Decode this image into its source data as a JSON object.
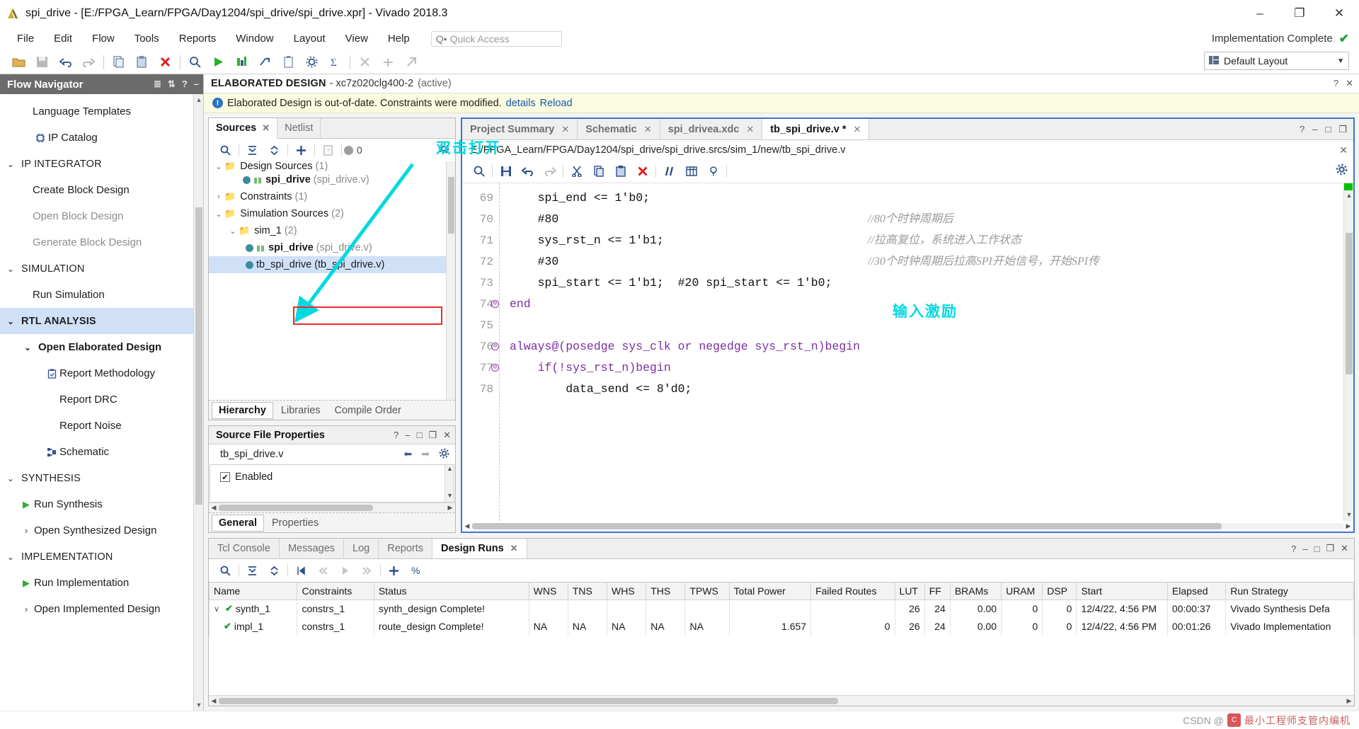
{
  "window": {
    "title": "spi_drive - [E:/FPGA_Learn/FPGA/Day1204/spi_drive/spi_drive.xpr] - Vivado 2018.3",
    "minimize": "–",
    "maximize": "❐",
    "close": "✕"
  },
  "menubar": {
    "items": [
      "File",
      "Edit",
      "Flow",
      "Tools",
      "Reports",
      "Window",
      "Layout",
      "View",
      "Help"
    ],
    "quick_access_placeholder": "Quick Access",
    "quick_access_value": "",
    "impl_status": "Implementation Complete",
    "impl_check": "✔"
  },
  "toolbar": {
    "layout_label": "Default Layout",
    "buttons": [
      "open-project-icon",
      "save-icon",
      "undo-icon",
      "redo-icon",
      "copy-icon",
      "paste-icon",
      "delete-icon",
      "search-icon",
      "run-icon",
      "report-icon",
      "launch-icon",
      "clipboard-icon",
      "settings-icon",
      "sum-icon",
      "marker1-icon",
      "marker2-icon",
      "marker3-icon"
    ]
  },
  "flow_navigator": {
    "header": "Flow Navigator",
    "items": [
      {
        "label": "Language Templates",
        "indent": 1,
        "icon": "",
        "state": "normal"
      },
      {
        "label": "IP Catalog",
        "indent": 1,
        "icon": "ip-catalog-icon",
        "state": "normal"
      },
      {
        "label": "IP INTEGRATOR",
        "indent": 0,
        "icon": "chevron-down-icon",
        "state": "section"
      },
      {
        "label": "Create Block Design",
        "indent": 1,
        "icon": "",
        "state": "normal"
      },
      {
        "label": "Open Block Design",
        "indent": 1,
        "icon": "",
        "state": "disabled"
      },
      {
        "label": "Generate Block Design",
        "indent": 1,
        "icon": "",
        "state": "disabled"
      },
      {
        "label": "SIMULATION",
        "indent": 0,
        "icon": "chevron-down-icon",
        "state": "section"
      },
      {
        "label": "Run Simulation",
        "indent": 1,
        "icon": "",
        "state": "normal"
      },
      {
        "label": "RTL ANALYSIS",
        "indent": 0,
        "icon": "chevron-down-icon",
        "state": "section-active"
      },
      {
        "label": "Open Elaborated Design",
        "indent": 1,
        "icon": "chevron-down-icon",
        "state": "bold"
      },
      {
        "label": "Report Methodology",
        "indent": 2,
        "icon": "methodology-icon",
        "state": "normal"
      },
      {
        "label": "Report DRC",
        "indent": 2,
        "icon": "",
        "state": "normal"
      },
      {
        "label": "Report Noise",
        "indent": 2,
        "icon": "",
        "state": "normal"
      },
      {
        "label": "Schematic",
        "indent": 2,
        "icon": "schematic-icon",
        "state": "normal"
      },
      {
        "label": "SYNTHESIS",
        "indent": 0,
        "icon": "chevron-down-icon",
        "state": "section"
      },
      {
        "label": "Run Synthesis",
        "indent": 1,
        "icon": "play-icon",
        "state": "normal"
      },
      {
        "label": "Open Synthesized Design",
        "indent": 1,
        "icon": "chevron-right-icon",
        "state": "normal"
      },
      {
        "label": "IMPLEMENTATION",
        "indent": 0,
        "icon": "chevron-down-icon",
        "state": "section"
      },
      {
        "label": "Run Implementation",
        "indent": 1,
        "icon": "play-icon",
        "state": "normal"
      },
      {
        "label": "Open Implemented Design",
        "indent": 1,
        "icon": "chevron-right-icon",
        "state": "normal"
      }
    ]
  },
  "design_bar": {
    "title": "ELABORATED DESIGN",
    "part": "- xc7z020clg400-2",
    "active": "(active)"
  },
  "banner": {
    "icon": "!",
    "text": "Elaborated Design is out-of-date. Constraints were modified.",
    "details_link": "details",
    "reload_link": "Reload"
  },
  "sources_panel": {
    "tabs": [
      {
        "label": "Sources",
        "active": true,
        "closable": true
      },
      {
        "label": "Netlist",
        "active": false,
        "closable": false
      }
    ],
    "tool_badge": "0",
    "tools": [
      "search-icon",
      "collapse-all-icon",
      "expand-all-icon",
      "add-sources-icon",
      "help-icon"
    ],
    "tree": [
      {
        "label": "Design Sources",
        "count": "(1)",
        "indent": 0,
        "chev": "down",
        "kind": "folder",
        "clipped": true
      },
      {
        "label": "spi_drive",
        "file": "(spi_drive.v)",
        "indent": 2,
        "chev": "",
        "kind": "module",
        "bold": true
      },
      {
        "label": "Constraints",
        "count": "(1)",
        "indent": 0,
        "chev": "right",
        "kind": "folder"
      },
      {
        "label": "Simulation Sources",
        "count": "(2)",
        "indent": 0,
        "chev": "down",
        "kind": "folder"
      },
      {
        "label": "sim_1",
        "count": "(2)",
        "indent": 1,
        "chev": "down",
        "kind": "folder"
      },
      {
        "label": "spi_drive",
        "file": "(spi_drive.v)",
        "indent": 2,
        "chev": "",
        "kind": "module",
        "bold": true
      },
      {
        "label": "tb_spi_drive",
        "file": "(tb_spi_drive.v)",
        "indent": 2,
        "chev": "",
        "kind": "file",
        "selected": true
      }
    ],
    "subtabs": [
      {
        "label": "Hierarchy",
        "active": true
      },
      {
        "label": "Libraries",
        "active": false
      },
      {
        "label": "Compile Order",
        "active": false
      }
    ]
  },
  "source_file_properties": {
    "title": "Source File Properties",
    "header_icons": [
      "?",
      "–",
      "□",
      "❐",
      "✕"
    ],
    "file_name": "tb_spi_drive.v",
    "enabled_label": "Enabled",
    "enabled_checked": "✔",
    "subtabs": [
      {
        "label": "General",
        "active": true
      },
      {
        "label": "Properties",
        "active": false
      }
    ]
  },
  "editor": {
    "tabs": [
      {
        "label": "Project Summary",
        "active": false
      },
      {
        "label": "Schematic",
        "active": false
      },
      {
        "label": "spi_drivea.xdc",
        "active": false
      },
      {
        "label": "tb_spi_drive.v *",
        "active": true
      }
    ],
    "path": "E:/FPGA_Learn/FPGA/Day1204/spi_drive/spi_drive.srcs/sim_1/new/tb_spi_drive.v",
    "header_icons": [
      "?",
      "–",
      "□",
      "❐"
    ],
    "tools": [
      "find-icon",
      "save-icon",
      "undo-icon",
      "redo-icon",
      "cut-icon",
      "copy-icon",
      "paste-icon",
      "delete-icon",
      "comment-icon",
      "columns-icon",
      "bulb-icon"
    ],
    "gear": "gear-icon",
    "lines": [
      {
        "num": "69",
        "fold": "",
        "code": "    spi_end <= 1'b0;",
        "comment": ""
      },
      {
        "num": "70",
        "fold": "",
        "code": "    #80",
        "comment": "//80个时钟周期后"
      },
      {
        "num": "71",
        "fold": "",
        "code": "    sys_rst_n <= 1'b1;",
        "comment": "//拉高复位，系统进入工作状态"
      },
      {
        "num": "72",
        "fold": "",
        "code": "    #30",
        "comment": "//30个时钟周期后拉高SPI开始信号，开始SPI传"
      },
      {
        "num": "73",
        "fold": "",
        "code": "    spi_start <= 1'b1;  #20 spi_start <= 1'b0;",
        "comment": ""
      },
      {
        "num": "74",
        "fold": "⊖",
        "code": "end",
        "comment": ""
      },
      {
        "num": "75",
        "fold": "",
        "code": "",
        "comment": ""
      },
      {
        "num": "76",
        "fold": "⊖",
        "code": "always@(posedge sys_clk or negedge sys_rst_n)begin",
        "comment": ""
      },
      {
        "num": "77",
        "fold": "⊖",
        "code": "    if(!sys_rst_n)begin",
        "comment": ""
      },
      {
        "num": "78",
        "fold": "",
        "code": "        data_send <= 8'd0;",
        "comment": ""
      }
    ]
  },
  "bottom_panel": {
    "tabs": [
      {
        "label": "Tcl Console",
        "active": false
      },
      {
        "label": "Messages",
        "active": false
      },
      {
        "label": "Log",
        "active": false
      },
      {
        "label": "Reports",
        "active": false
      },
      {
        "label": "Design Runs",
        "active": true,
        "closable": true
      }
    ],
    "header_icons": [
      "?",
      "–",
      "□",
      "❐",
      "✕"
    ],
    "tools": [
      "search-icon",
      "collapse-icon",
      "expand-icon",
      "first-icon",
      "prev-icon",
      "play-icon",
      "next-icon",
      "add-icon",
      "percent-icon"
    ],
    "columns": [
      "Name",
      "Constraints",
      "Status",
      "WNS",
      "TNS",
      "WHS",
      "THS",
      "TPWS",
      "Total Power",
      "Failed Routes",
      "LUT",
      "FF",
      "BRAMs",
      "URAM",
      "DSP",
      "Start",
      "Elapsed",
      "Run Strategy"
    ],
    "rows": [
      {
        "name": "synth_1",
        "chev": "∨",
        "ok": "✔",
        "constraints": "constrs_1",
        "status": "synth_design Complete!",
        "wns": "",
        "tns": "",
        "whs": "",
        "ths": "",
        "tpws": "",
        "total_power": "",
        "failed_routes": "",
        "lut": "26",
        "ff": "24",
        "brams": "0.00",
        "uram": "0",
        "dsp": "0",
        "start": "12/4/22, 4:56 PM",
        "elapsed": "00:00:37",
        "run_strategy": "Vivado Synthesis Defa"
      },
      {
        "name": "impl_1",
        "chev": "",
        "ok": "✔",
        "constraints": "constrs_1",
        "status": "route_design Complete!",
        "wns": "NA",
        "tns": "NA",
        "whs": "NA",
        "ths": "NA",
        "tpws": "NA",
        "total_power": "1.657",
        "failed_routes": "0",
        "lut": "26",
        "ff": "24",
        "brams": "0.00",
        "uram": "0",
        "dsp": "0",
        "start": "12/4/22, 4:56 PM",
        "elapsed": "00:01:26",
        "run_strategy": "Vivado Implementation"
      }
    ]
  },
  "annotations": [
    {
      "text": "双击打开",
      "name": "annotation-double-click-to-open"
    },
    {
      "text": "输入激励",
      "name": "annotation-input-stimulus"
    }
  ],
  "watermark": {
    "prefix": "CSDN @",
    "cjk": "最小工程师支管内编机"
  },
  "colors": {
    "accent": "#4472c4",
    "annotation": "#00d9e0",
    "red_box": "#ef2a2a",
    "selection": "#cfe0f7",
    "success": "#1f9c3a",
    "banner_bg": "#fbfbdf"
  }
}
